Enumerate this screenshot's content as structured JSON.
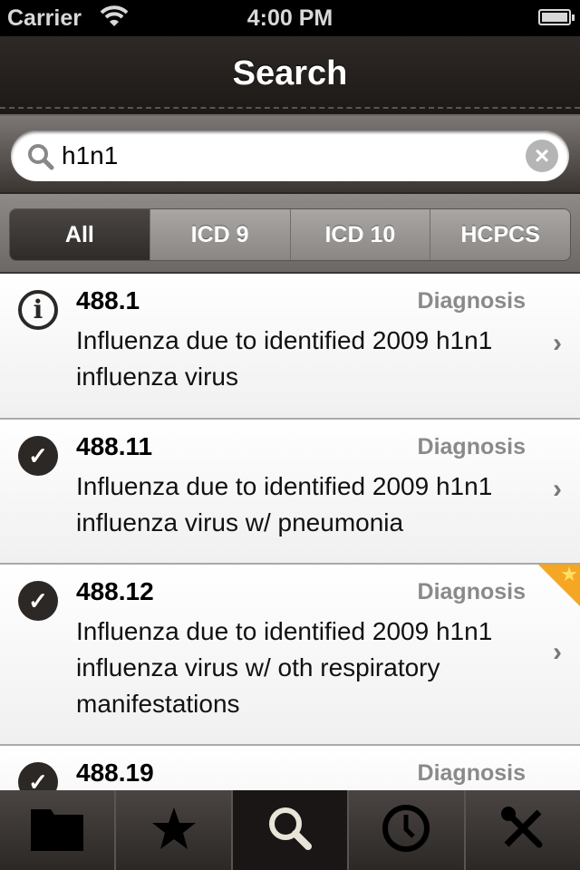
{
  "status": {
    "carrier": "Carrier",
    "time": "4:00 PM",
    "battery_level": 1.0
  },
  "nav": {
    "title": "Search"
  },
  "search": {
    "value": "h1n1"
  },
  "segments": [
    {
      "label": "All",
      "active": true
    },
    {
      "label": "ICD 9"
    },
    {
      "label": "ICD 10"
    },
    {
      "label": "HCPCS"
    }
  ],
  "results": [
    {
      "code": "488.1",
      "type": "Diagnosis",
      "desc": "Influenza due to identified 2009 h1n1 influenza virus",
      "icon": "info-icon",
      "favorite": false
    },
    {
      "code": "488.11",
      "type": "Diagnosis",
      "desc": "Influenza due to identified 2009 h1n1 influenza virus w/ pneumonia",
      "icon": "check-icon",
      "favorite": false
    },
    {
      "code": "488.12",
      "type": "Diagnosis",
      "desc": "Influenza due to identified 2009 h1n1 influenza virus w/ oth respiratory manifestations",
      "icon": "check-icon",
      "favorite": true
    },
    {
      "code": "488.19",
      "type": "Diagnosis",
      "desc": "",
      "icon": "check-icon",
      "favorite": false
    }
  ],
  "tabs": [
    {
      "icon": "folder-icon"
    },
    {
      "icon": "star-icon"
    },
    {
      "icon": "search-icon",
      "active": true
    },
    {
      "icon": "clock-icon"
    },
    {
      "icon": "tools-icon"
    }
  ],
  "colors": {
    "nav_bg": "#2e2926",
    "favorite": "#f5a623",
    "active_tab": "#1a1615"
  }
}
